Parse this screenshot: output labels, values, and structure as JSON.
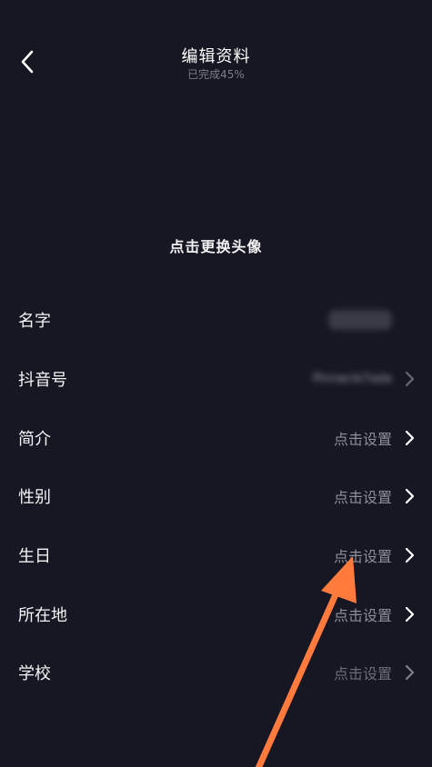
{
  "header": {
    "title": "编辑资料",
    "subtitle": "已完成45%"
  },
  "avatar": {
    "hint": "点击更换头像"
  },
  "rows": [
    {
      "label": "名字",
      "value": "      ",
      "blurred": true,
      "chevron": false
    },
    {
      "label": "抖音号",
      "value": "Pinnacle7ada",
      "blurred": true,
      "chevron": true
    },
    {
      "label": "简介",
      "value": "点击设置",
      "blurred": false,
      "chevron": true
    },
    {
      "label": "性别",
      "value": "点击设置",
      "blurred": false,
      "chevron": true
    },
    {
      "label": "生日",
      "value": "点击设置",
      "blurred": false,
      "chevron": true
    },
    {
      "label": "所在地",
      "value": "点击设置",
      "blurred": false,
      "chevron": true
    },
    {
      "label": "学校",
      "value": "点击设置",
      "blurred": false,
      "chevron": true
    }
  ],
  "colors": {
    "background": "#161722",
    "annotation_arrow": "#ff7a3c"
  },
  "icons": {
    "back": "back-chevron-icon",
    "row_chevron": "chevron-right-icon",
    "annotation": "annotation-arrow-icon"
  }
}
